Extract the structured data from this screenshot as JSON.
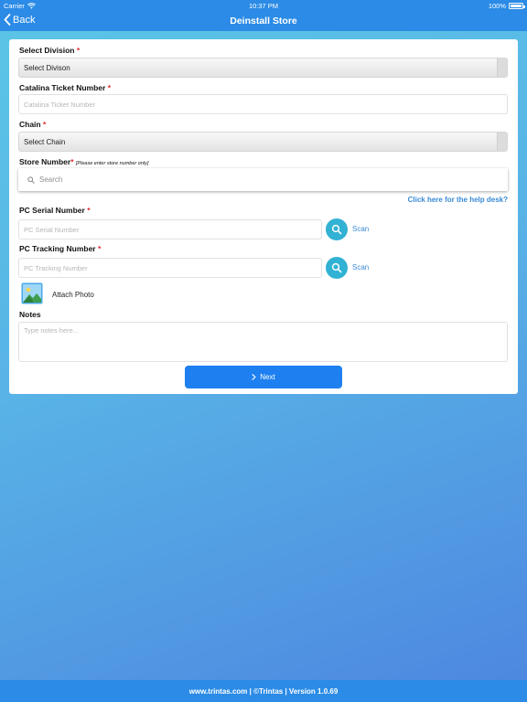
{
  "status_bar": {
    "carrier": "Carrier",
    "time": "10:37 PM",
    "battery": "100%"
  },
  "nav": {
    "back_label": "Back",
    "title": "Deinstall Store"
  },
  "form": {
    "division": {
      "label": "Select Division",
      "required_mark": "*",
      "value": "Select Divison"
    },
    "ticket": {
      "label": "Catalina Ticket Number",
      "required_mark": "*",
      "placeholder": "Catalina Ticket Number"
    },
    "chain": {
      "label": "Chain",
      "required_mark": "*",
      "value": "Select Chain"
    },
    "store": {
      "label": "Store Number",
      "required_mark": "*",
      "hint": "[Please enter store number only]",
      "search_placeholder": "Search"
    },
    "help_link": "Click here for the help desk?",
    "pc_serial": {
      "label": "PC Serial Number",
      "required_mark": "*",
      "placeholder": "PC Serial Number",
      "scan_label": "Scan"
    },
    "pc_tracking": {
      "label": "PC Tracking Number",
      "required_mark": "*",
      "placeholder": "PC Tracking Number",
      "scan_label": "Scan"
    },
    "attach_photo": "Attach Photo",
    "notes": {
      "label": "Notes",
      "placeholder": "Type notes here..."
    },
    "next_label": "Next"
  },
  "footer": "www.trintas.com | ©Trintas | Version 1.0.69",
  "colors": {
    "bar": "#2b8be6",
    "accent": "#31b2d4",
    "link": "#3a8ad6",
    "required": "#e0262a",
    "button": "#1e80f0"
  }
}
